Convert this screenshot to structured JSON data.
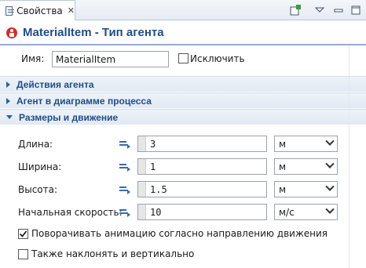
{
  "tab": {
    "label": "Свойства",
    "close_glyph": "✕"
  },
  "toolbar": {
    "icons": [
      "new-view-icon",
      "view-menu-icon",
      "minimize-icon",
      "maximize-icon"
    ]
  },
  "header": {
    "title": "MaterialItem - Тип агента",
    "icon": "agent-icon",
    "icon_color": "#cf2d2d"
  },
  "name_row": {
    "label": "Имя:",
    "value": "MaterialItem",
    "exclude_label": "Исключить",
    "exclude_checked": false
  },
  "sections": [
    {
      "label": "Действия агента",
      "expanded": false
    },
    {
      "label": "Агент в диаграмме процесса",
      "expanded": false
    },
    {
      "label": "Размеры и движение",
      "expanded": true
    }
  ],
  "properties": [
    {
      "label": "Длина:",
      "value": "3",
      "unit": "м"
    },
    {
      "label": "Ширина:",
      "value": "1",
      "unit": "м"
    },
    {
      "label": "Высота:",
      "value": "1.5",
      "unit": "м"
    },
    {
      "label": "Начальная скорость:",
      "value": "10",
      "unit": "м/с"
    }
  ],
  "options": [
    {
      "label": "Поворачивать анимацию согласно направлению движения",
      "checked": true
    },
    {
      "label": "Также наклонять и вертикально",
      "checked": false
    }
  ],
  "colors": {
    "accent": "#1e4d86",
    "section_bg": "#e1e9f3"
  }
}
